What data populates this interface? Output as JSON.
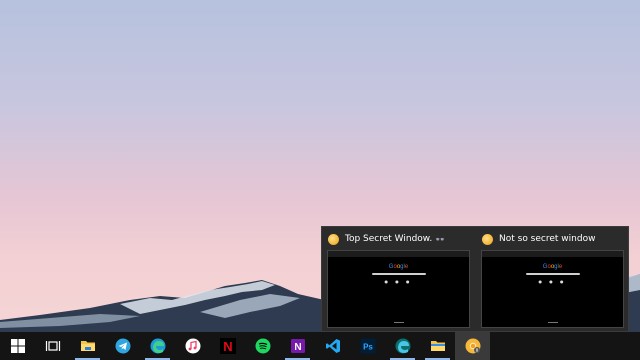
{
  "desktop": {
    "colors": {
      "sky_top": "#b6c2de",
      "sky_bottom": "#f5d7d6",
      "taskbar": "#141414"
    }
  },
  "taskbar": {
    "items": [
      {
        "name": "start-button",
        "icon": "windows-logo-icon"
      },
      {
        "name": "task-view-button",
        "icon": "task-view-icon"
      },
      {
        "name": "file-explorer-button",
        "icon": "folder-icon"
      },
      {
        "name": "telegram-button",
        "icon": "telegram-icon"
      },
      {
        "name": "edge-button",
        "icon": "edge-icon"
      },
      {
        "name": "itunes-button",
        "icon": "itunes-icon"
      },
      {
        "name": "netflix-button",
        "icon": "netflix-icon"
      },
      {
        "name": "spotify-button",
        "icon": "spotify-icon"
      },
      {
        "name": "onenote-button",
        "icon": "onenote-icon"
      },
      {
        "name": "vscode-button",
        "icon": "vscode-icon"
      },
      {
        "name": "photoshop-button",
        "icon": "photoshop-icon"
      },
      {
        "name": "edge-dev-button",
        "icon": "edge-dev-icon"
      },
      {
        "name": "file-explorer-2-button",
        "icon": "folder-icon"
      },
      {
        "name": "chrome-canary-button",
        "icon": "chrome-canary-icon"
      }
    ],
    "labels": {
      "netflix": "N",
      "onenote": "N",
      "photoshop": "Ps"
    }
  },
  "previews": [
    {
      "title": "Top Secret Window.",
      "extra": "👓",
      "google_text": "Google"
    },
    {
      "title": "Not so secret window",
      "extra": "",
      "google_text": "Google"
    }
  ]
}
